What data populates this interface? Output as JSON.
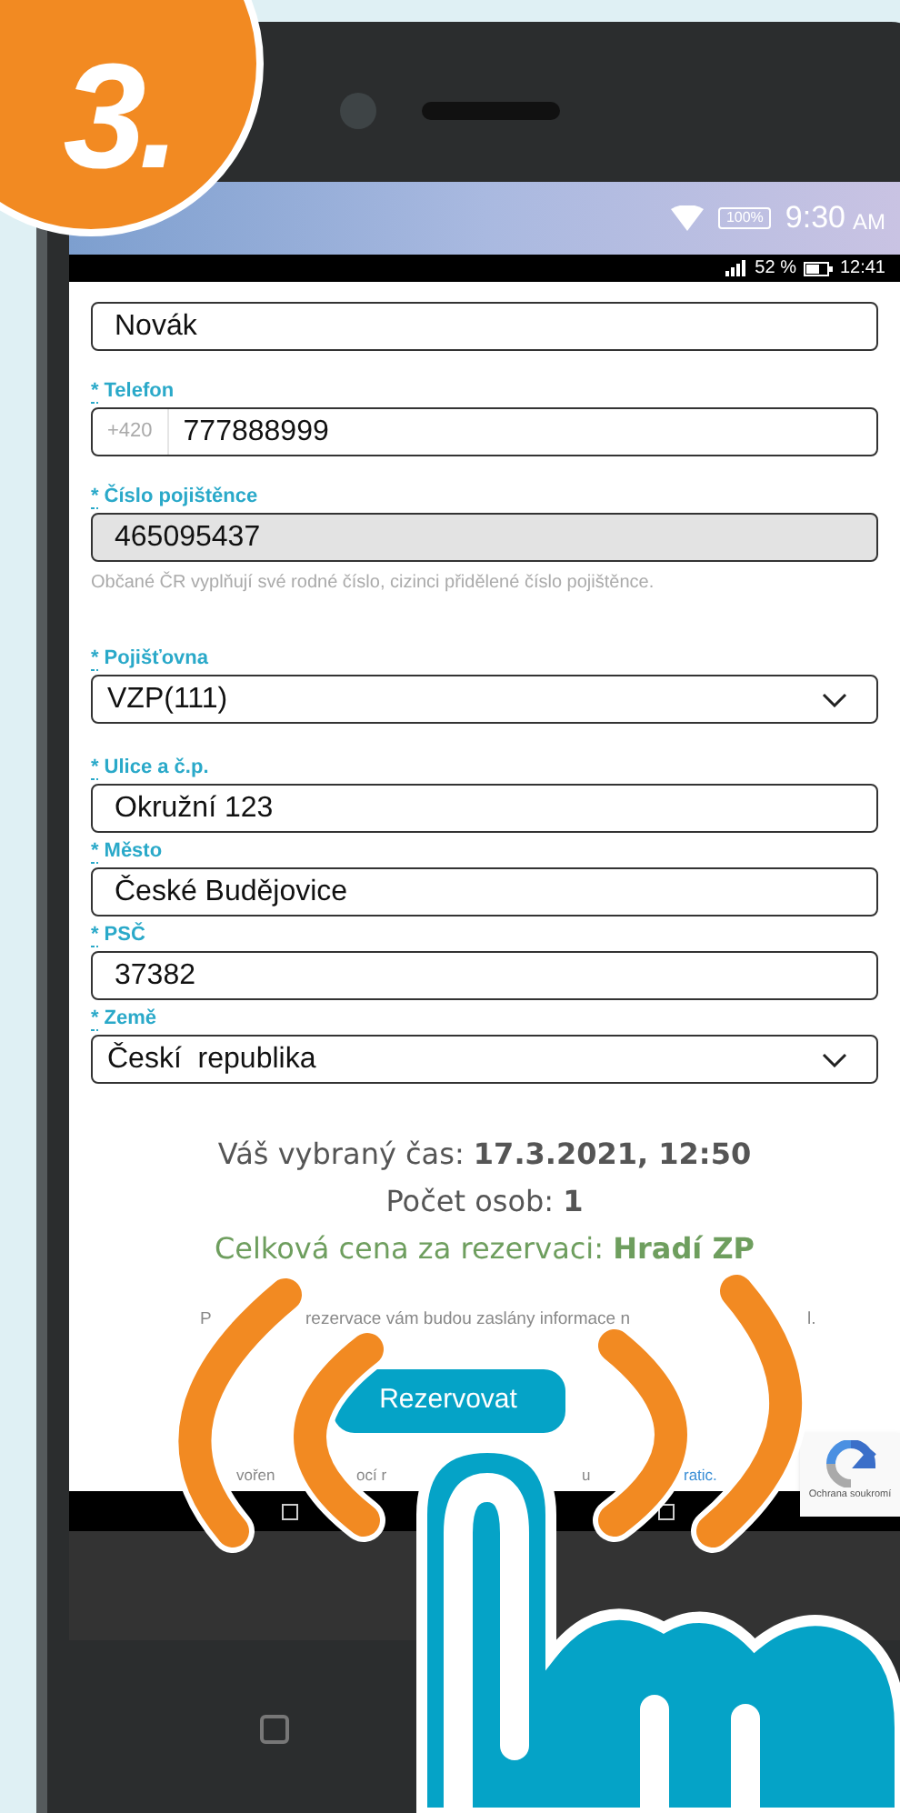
{
  "badge": {
    "text": "3."
  },
  "device_status": {
    "battery": "100%",
    "time": "9:30",
    "meridiem": "AM"
  },
  "app_status": {
    "battery": "52 %",
    "time": "12:41"
  },
  "form": {
    "fields": [
      {
        "kind": "text",
        "value": "Novák",
        "disabled": false
      },
      {
        "kind": "phone",
        "marker": "*",
        "label": "Telefon",
        "prefix": "+420",
        "value": "777888999",
        "disabled": false
      },
      {
        "kind": "text",
        "marker": "*",
        "label": "Číslo pojištěnce",
        "value": "465095437",
        "disabled": true,
        "hint": "Občané ČR vyplňují své rodné číslo, cizinci přidělené číslo pojištěnce."
      },
      {
        "kind": "select",
        "marker": "*",
        "label": "Pojišťovna",
        "value": "VZP(111)",
        "disabled": false
      },
      {
        "kind": "text",
        "marker": "*",
        "label": "Ulice a č.p.",
        "value": "Okružní 123",
        "disabled": false
      },
      {
        "kind": "text",
        "marker": "*",
        "label": "Město",
        "value": "České Budějovice",
        "disabled": false
      },
      {
        "kind": "text",
        "marker": "*",
        "label": "PSČ",
        "value": "37382",
        "disabled": false
      },
      {
        "kind": "select",
        "marker": "*",
        "label": "Země",
        "value": "Českí  republika",
        "disabled": false
      }
    ]
  },
  "summary": [
    {
      "kind": "plain",
      "text": "Váš vybraný čas: **17.3.2021, 12:50**"
    },
    {
      "kind": "plain",
      "text": "Počet osob: **1**"
    },
    {
      "kind": "price",
      "text": "Celková cena za rezervaci: **Hradí ZP**"
    }
  ],
  "info_fragments": [
    "P",
    "rezervace vám budou zaslány informace n",
    "l."
  ],
  "submit": {
    "label": "Rezervovat"
  },
  "footer_fragments": [
    {
      "text": "vořen",
      "link": false
    },
    {
      "text": "ocí r",
      "link": false
    },
    {
      "text": "u",
      "link": false
    },
    {
      "text": "ratic.",
      "link": true
    }
  ],
  "recaptcha": {
    "label": "Ochrana soukromí"
  }
}
